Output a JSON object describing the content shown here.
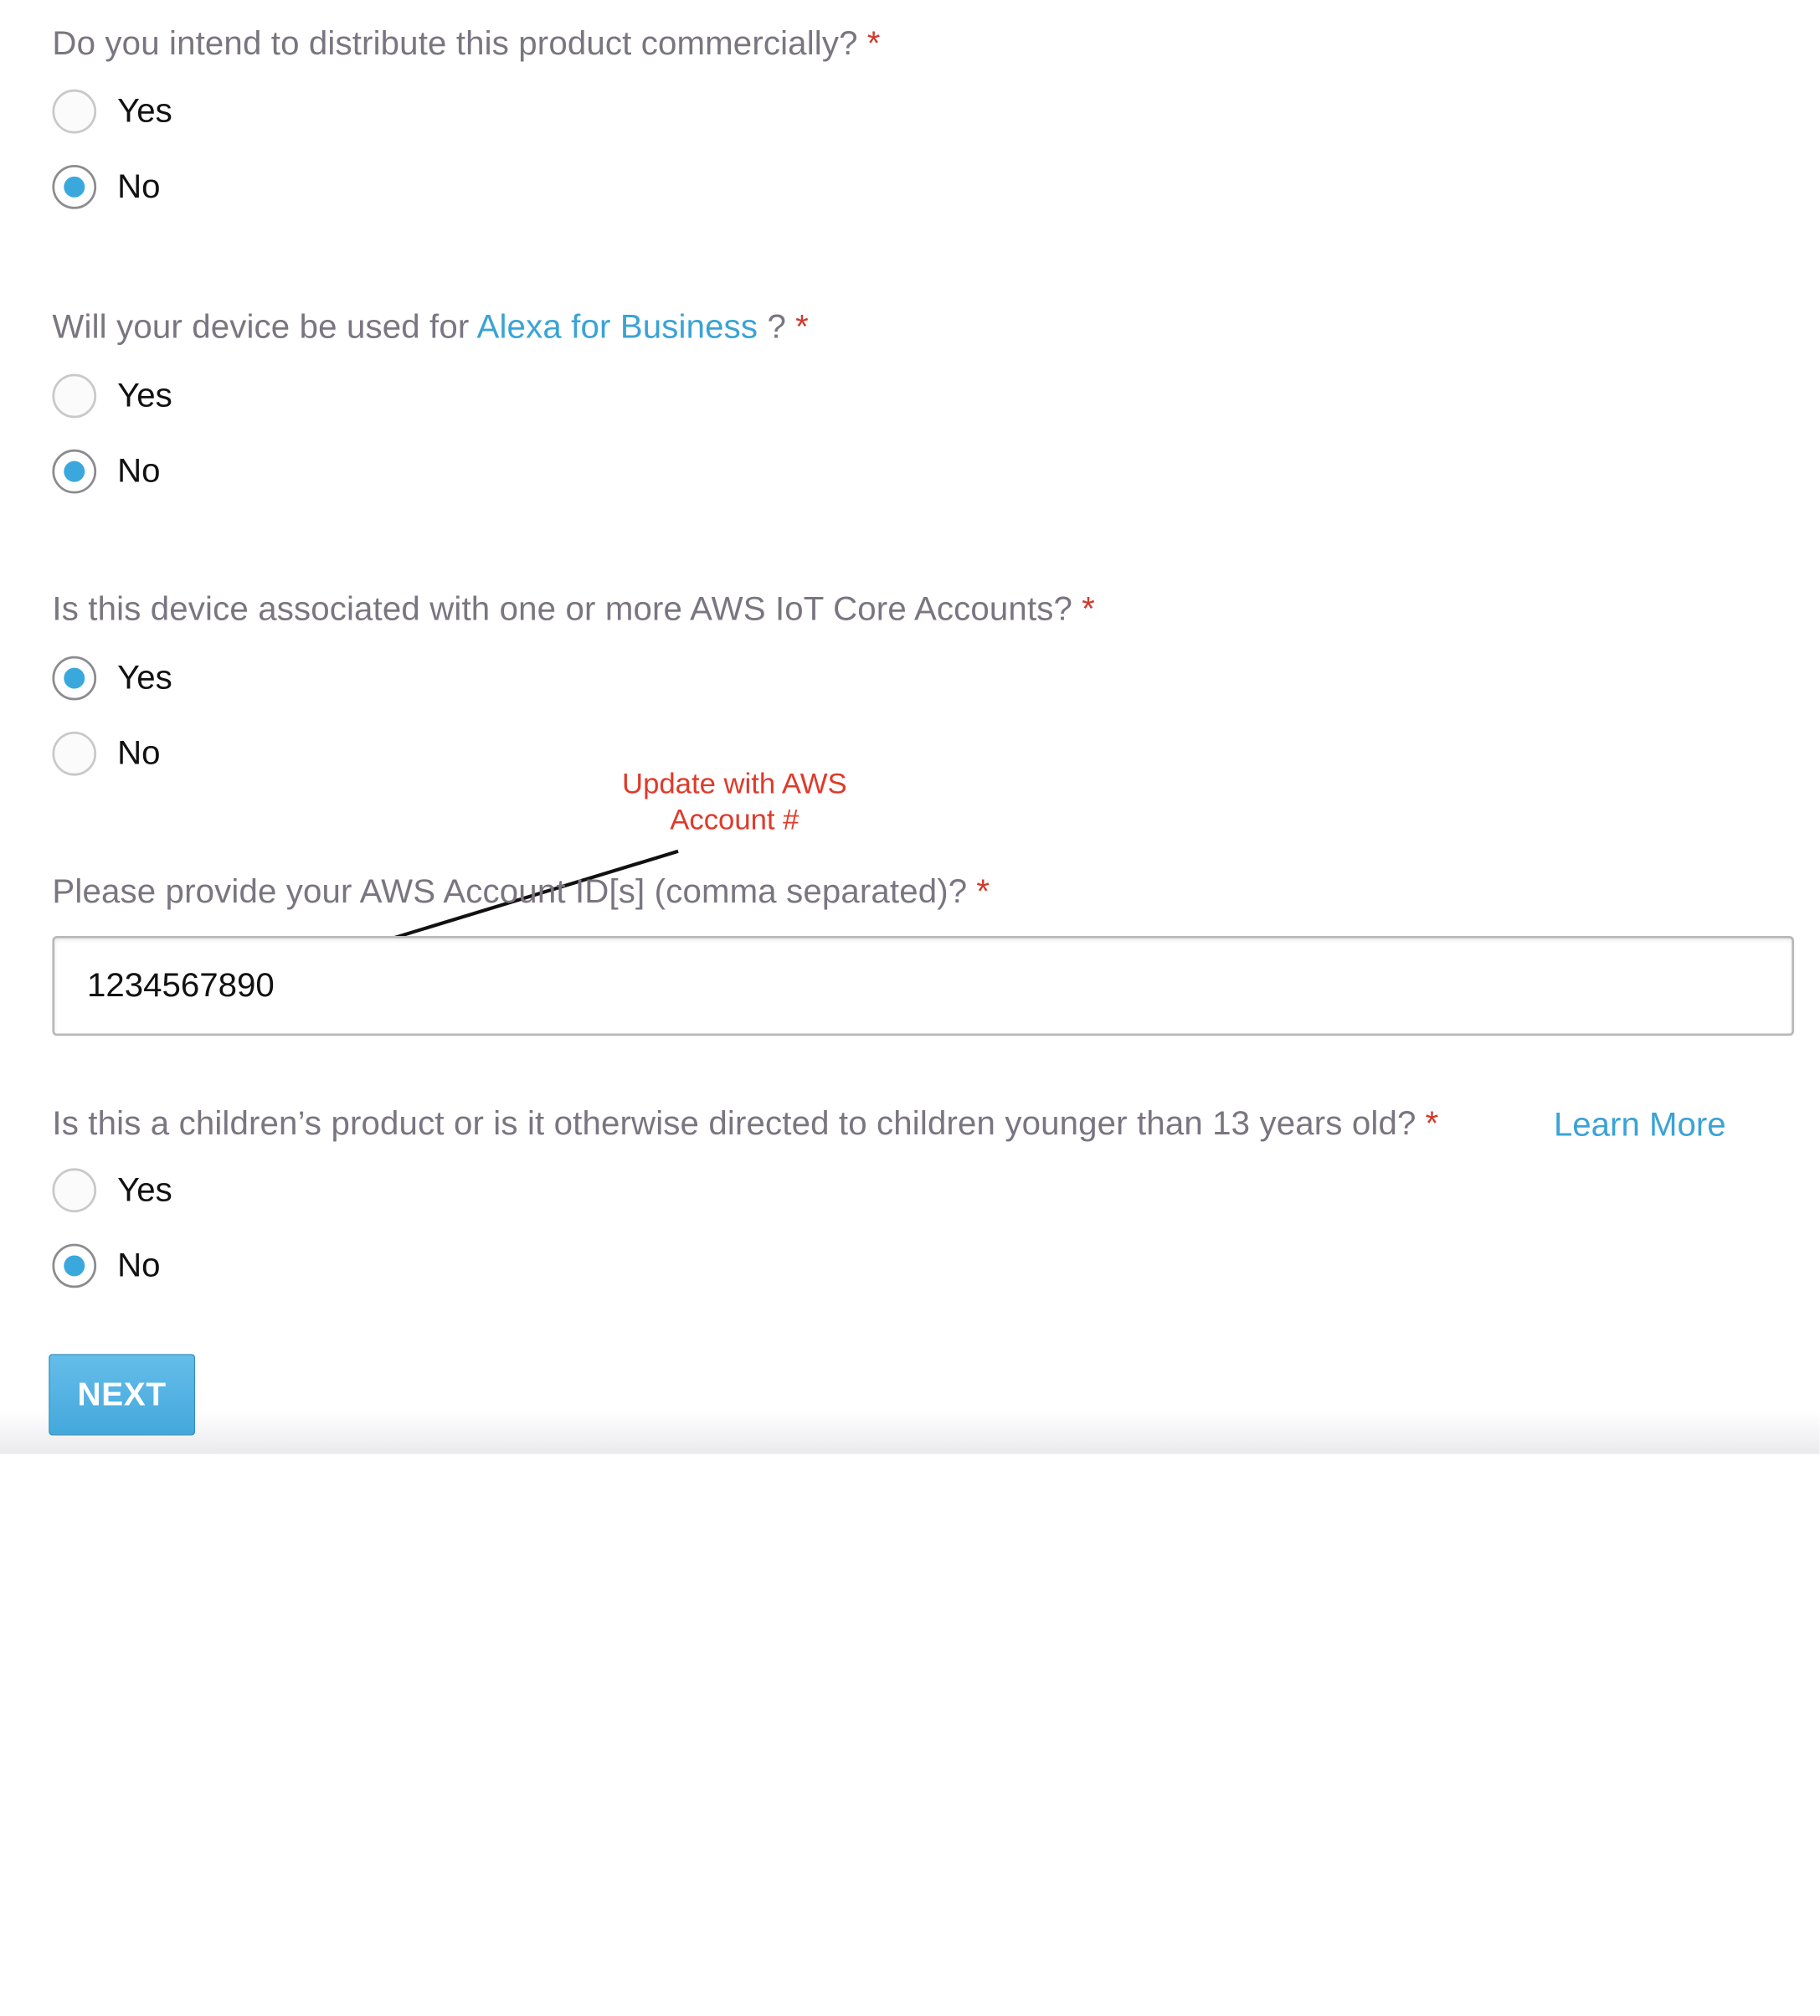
{
  "form": {
    "q1": {
      "text": "Do you intend to distribute this product commercially?",
      "required_mark": "*",
      "options": [
        {
          "label": "Yes",
          "selected": false
        },
        {
          "label": "No",
          "selected": true
        }
      ]
    },
    "q2": {
      "text_before": "Will your device be used for ",
      "link": "Alexa for Business",
      "text_after": " ?",
      "required_mark": "*",
      "options": [
        {
          "label": "Yes",
          "selected": false
        },
        {
          "label": "No",
          "selected": true
        }
      ]
    },
    "q3": {
      "text": "Is this device associated with one or more AWS IoT Core Accounts?",
      "required_mark": "*",
      "options": [
        {
          "label": "Yes",
          "selected": true
        },
        {
          "label": "No",
          "selected": false
        }
      ]
    },
    "q4": {
      "text": "Please provide your AWS Account ID[s] (comma separated)?",
      "required_mark": "*",
      "value": "1234567890"
    },
    "q5": {
      "text": "Is this a children’s product or is it otherwise directed to children younger than 13 years old?",
      "required_mark": "*",
      "learn_more": "Learn More",
      "options": [
        {
          "label": "Yes",
          "selected": false
        },
        {
          "label": "No",
          "selected": true
        }
      ]
    },
    "next_label": "NEXT"
  },
  "annotation": {
    "text": "Update with AWS Account #",
    "color": "#e03a2a"
  },
  "colors": {
    "accent": "#3aa8dc",
    "link": "#3aa3d6",
    "required": "#d0392b",
    "question_text": "#7a7580"
  }
}
